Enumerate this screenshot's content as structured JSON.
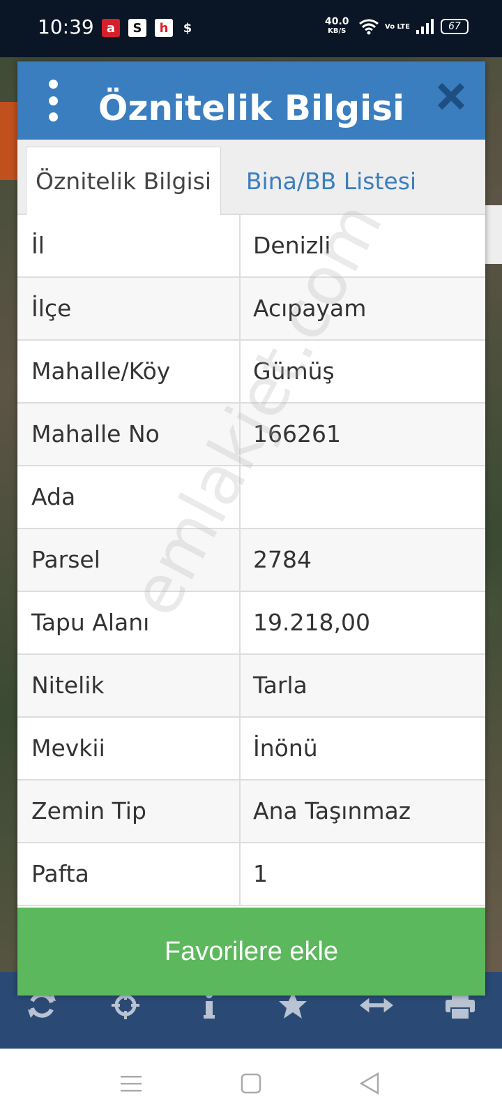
{
  "status_bar": {
    "time": "10:39",
    "app_icons": [
      "a",
      "S",
      "h",
      "$"
    ],
    "net_speed": "40.0",
    "net_speed_unit": "KB/S",
    "volte": "Vo LTE",
    "battery": "67"
  },
  "dialog": {
    "title": "Öznitelik Bilgisi",
    "tabs": [
      {
        "label": "Öznitelik Bilgisi",
        "active": true
      },
      {
        "label": "Bina/BB Listesi",
        "active": false
      }
    ],
    "rows": [
      {
        "key": "İl",
        "value": "Denizli"
      },
      {
        "key": "İlçe",
        "value": "Acıpayam"
      },
      {
        "key": "Mahalle/Köy",
        "value": "Gümüş"
      },
      {
        "key": "Mahalle No",
        "value": "166261"
      },
      {
        "key": "Ada",
        "value": ""
      },
      {
        "key": "Parsel",
        "value": "2784"
      },
      {
        "key": "Tapu Alanı",
        "value": "19.218,00"
      },
      {
        "key": "Nitelik",
        "value": "Tarla"
      },
      {
        "key": "Mevkii",
        "value": "İnönü"
      },
      {
        "key": "Zemin Tip",
        "value": "Ana Taşınmaz"
      },
      {
        "key": "Pafta",
        "value": "1"
      }
    ],
    "favorite_button": "Favorilere ekle",
    "watermark": "emlakjet.com"
  },
  "toolbar": {
    "icons": [
      "refresh-icon",
      "crosshair-icon",
      "info-icon",
      "star-icon",
      "measure-icon",
      "print-icon"
    ]
  },
  "colors": {
    "header_blue": "#3a7ebf",
    "button_green": "#5cb85c",
    "toolbar_blue": "#2a4a75"
  }
}
